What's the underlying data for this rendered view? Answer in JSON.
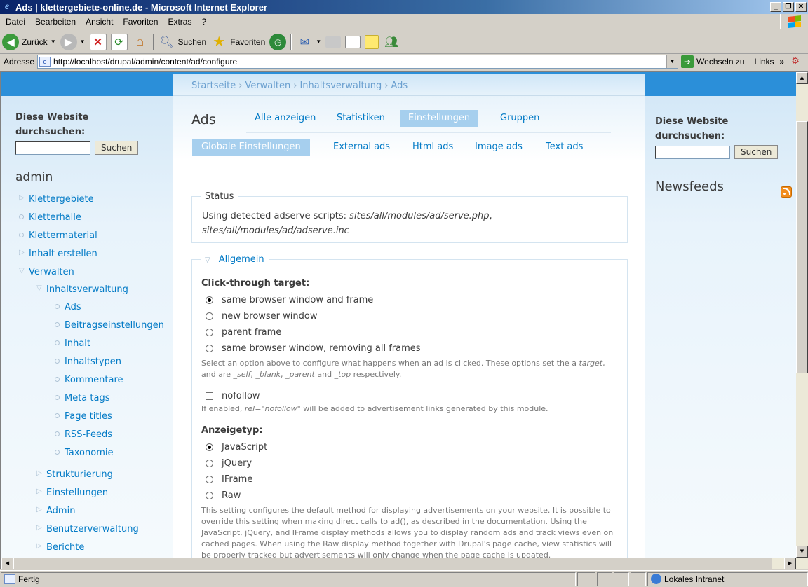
{
  "window": {
    "title": "Ads | klettergebiete-online.de - Microsoft Internet Explorer",
    "controls": [
      "_",
      "❐",
      "✕"
    ]
  },
  "menu": [
    "Datei",
    "Bearbeiten",
    "Ansicht",
    "Favoriten",
    "Extras",
    "?"
  ],
  "toolbar": {
    "back": "Zurück",
    "search": "Suchen",
    "favorites": "Favoriten"
  },
  "address": {
    "label": "Adresse",
    "url": "http://localhost/drupal/admin/content/ad/configure",
    "go": "Wechseln zu",
    "links": "Links"
  },
  "search_block": {
    "title_line1": "Diese Website",
    "title_line2": "durchsuchen:",
    "button": "Suchen"
  },
  "user": "admin",
  "nav": {
    "top": [
      "Klettergebiete",
      "Kletterhalle",
      "Klettermaterial",
      "Inhalt erstellen",
      "Verwalten"
    ],
    "verwalten_sub": [
      "Inhaltsverwaltung"
    ],
    "inhaltsverwaltung_sub": [
      "Ads",
      "Beitragseinstellungen",
      "Inhalt",
      "Inhaltstypen",
      "Kommentare",
      "Meta tags",
      "Page titles",
      "RSS-Feeds",
      "Taxonomie"
    ],
    "verwalten_more": [
      "Strukturierung",
      "Einstellungen",
      "Admin",
      "Benutzerverwaltung",
      "Berichte"
    ]
  },
  "breadcrumb": [
    "Startseite",
    "Verwalten",
    "Inhaltsverwaltung",
    "Ads"
  ],
  "page_title": "Ads",
  "primary_tabs": [
    "Alle anzeigen",
    "Statistiken",
    "Einstellungen",
    "Gruppen"
  ],
  "secondary_tabs": [
    "Globale Einstellungen",
    "External ads",
    "Html ads",
    "Image ads",
    "Text ads"
  ],
  "status": {
    "legend": "Status",
    "prefix": "Using detected adserve scripts: ",
    "script1": "sites/all/modules/ad/serve.php",
    "sep": ",",
    "script2": "sites/all/modules/ad/adserve.inc"
  },
  "allgemein": {
    "legend": "Allgemein",
    "click_label": "Click-through target:",
    "click_options": [
      "same browser window and frame",
      "new browser window",
      "parent frame",
      "same browser window, removing all frames"
    ],
    "click_selected": 0,
    "click_desc_1": "Select an option above to configure what happens when an ad is clicked. These options set the a",
    "click_desc_target": "target",
    "click_desc_2": ", and are",
    "click_desc_self": "_self",
    "click_desc_blank": "_blank",
    "click_desc_parent": "_parent",
    "click_desc_and": "and",
    "click_desc_top": "_top",
    "click_desc_end": "respectively.",
    "nofollow_label": "nofollow",
    "nofollow_checked": false,
    "nofollow_desc_1": "If enabled,",
    "nofollow_desc_rel": "rel=\"nofollow\"",
    "nofollow_desc_2": "will be added to advertisement links generated by this module.",
    "display_label": "Anzeigetyp:",
    "display_options": [
      "JavaScript",
      "jQuery",
      "IFrame",
      "Raw"
    ],
    "display_selected": 0,
    "display_desc": "This setting configures the default method for displaying advertisements on your website. It is possible to override this setting when making direct calls to ad(), as described in the documentation. Using the JavaScript, jQuery, and IFrame display methods allows you to display random ads and track views even on cached pages. When using the Raw display method together with Drupal's page cache, view statistics will be properly tracked but advertisements will only change when the page cache is updated."
  },
  "right": {
    "newsfeeds": "Newsfeeds"
  },
  "statusbar": {
    "text": "Fertig",
    "zone": "Lokales Intranet"
  }
}
